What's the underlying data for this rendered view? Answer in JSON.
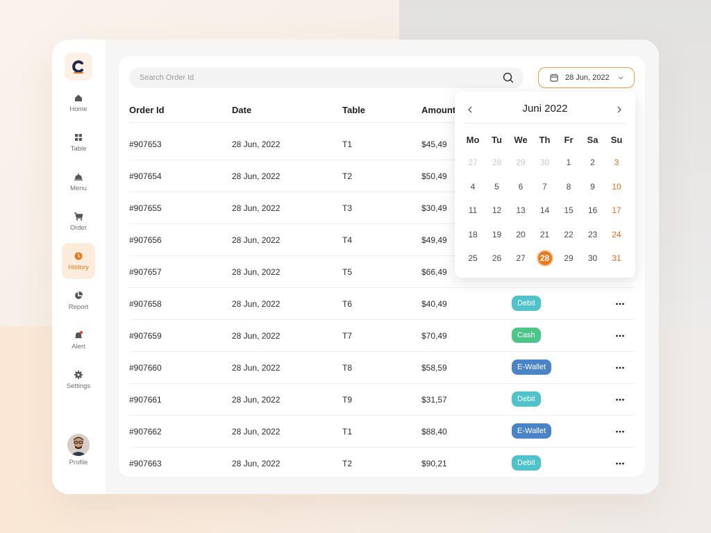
{
  "sidebar": {
    "items": [
      {
        "label": "Home",
        "icon": "home-icon"
      },
      {
        "label": "Table",
        "icon": "grid-icon"
      },
      {
        "label": "Menu",
        "icon": "cloche-icon"
      },
      {
        "label": "Order",
        "icon": "cart-icon"
      },
      {
        "label": "History",
        "icon": "clock-icon",
        "active": true
      },
      {
        "label": "Report",
        "icon": "pie-chart-icon"
      },
      {
        "label": "Alert",
        "icon": "bell-icon"
      },
      {
        "label": "Settings",
        "icon": "gear-icon"
      }
    ],
    "profile_label": "Profile"
  },
  "search": {
    "placeholder": "Search Order Id"
  },
  "date_filter": {
    "value": "28 Jun, 2022"
  },
  "table": {
    "headers": {
      "order_id": "Order Id",
      "date": "Date",
      "table": "Table",
      "amount": "Amount"
    },
    "rows": [
      {
        "order_id": "#907653",
        "date": "28 Jun, 2022",
        "table": "T1",
        "amount": "$45,49",
        "payment": ""
      },
      {
        "order_id": "#907654",
        "date": "28 Jun, 2022",
        "table": "T2",
        "amount": "$50,49",
        "payment": ""
      },
      {
        "order_id": "#907655",
        "date": "28 Jun, 2022",
        "table": "T3",
        "amount": "$30,49",
        "payment": ""
      },
      {
        "order_id": "#907656",
        "date": "28 Jun, 2022",
        "table": "T4",
        "amount": "$49,49",
        "payment": ""
      },
      {
        "order_id": "#907657",
        "date": "28 Jun, 2022",
        "table": "T5",
        "amount": "$66,49",
        "payment": ""
      },
      {
        "order_id": "#907658",
        "date": "28 Jun, 2022",
        "table": "T6",
        "amount": "$40,49",
        "payment": "Debit"
      },
      {
        "order_id": "#907659",
        "date": "28 Jun, 2022",
        "table": "T7",
        "amount": "$70,49",
        "payment": "Cash"
      },
      {
        "order_id": "#907660",
        "date": "28 Jun, 2022",
        "table": "T8",
        "amount": "$58,59",
        "payment": "E-Wallet"
      },
      {
        "order_id": "#907661",
        "date": "28 Jun, 2022",
        "table": "T9",
        "amount": "$31,57",
        "payment": "Debit"
      },
      {
        "order_id": "#907662",
        "date": "28 Jun, 2022",
        "table": "T1",
        "amount": "$88,40",
        "payment": "E-Wallet"
      },
      {
        "order_id": "#907663",
        "date": "28 Jun, 2022",
        "table": "T2",
        "amount": "$90,21",
        "payment": "Debit"
      }
    ]
  },
  "payment_colors": {
    "Debit": "#4fc3c9",
    "Cash": "#4cc48a",
    "E-Wallet": "#4a84c6"
  },
  "calendar": {
    "title": "Juni 2022",
    "weekdays": [
      "Mo",
      "Tu",
      "We",
      "Th",
      "Fr",
      "Sa",
      "Su"
    ],
    "weeks": [
      [
        "27",
        "28",
        "29",
        "30",
        "1",
        "2",
        "3"
      ],
      [
        "4",
        "5",
        "6",
        "7",
        "8",
        "9",
        "10"
      ],
      [
        "11",
        "12",
        "13",
        "14",
        "15",
        "16",
        "17"
      ],
      [
        "18",
        "19",
        "20",
        "21",
        "22",
        "23",
        "24"
      ],
      [
        "25",
        "26",
        "27",
        "28",
        "29",
        "30",
        "31"
      ]
    ],
    "muted_first_week_count": 4,
    "selected_day": "28",
    "accent_color": "#e8791c",
    "weekend_color": "#ec6a1c"
  }
}
